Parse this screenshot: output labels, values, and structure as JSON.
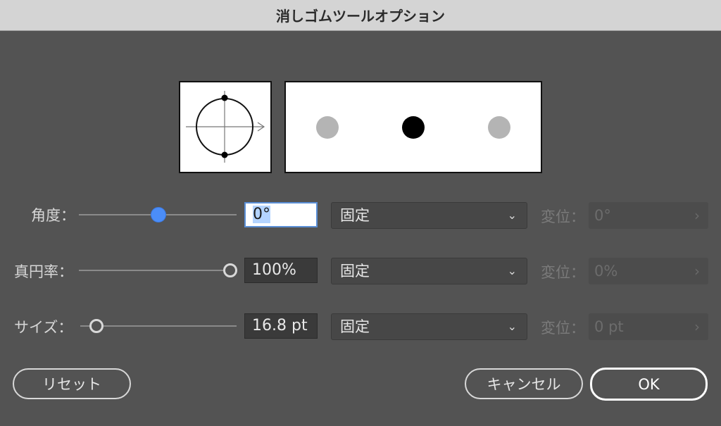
{
  "window": {
    "title": "消しゴムツールオプション"
  },
  "rows": [
    {
      "label": "角度：",
      "value": "0°",
      "mode": "固定",
      "variation_label": "変位：",
      "variation_value": "0°"
    },
    {
      "label": "真円率：",
      "value": "100%",
      "mode": "固定",
      "variation_label": "変位：",
      "variation_value": "0%"
    },
    {
      "label": "サイズ：",
      "value": "16.8 pt",
      "mode": "固定",
      "variation_label": "変位：",
      "variation_value": "0 pt"
    }
  ],
  "buttons": {
    "reset": "リセット",
    "cancel": "キャンセル",
    "ok": "OK"
  },
  "icons": {
    "dropdown": "chevron-down-icon",
    "variation": "chevron-right-icon"
  },
  "colors": {
    "background": "#535353",
    "accent": "#4b8df8"
  }
}
